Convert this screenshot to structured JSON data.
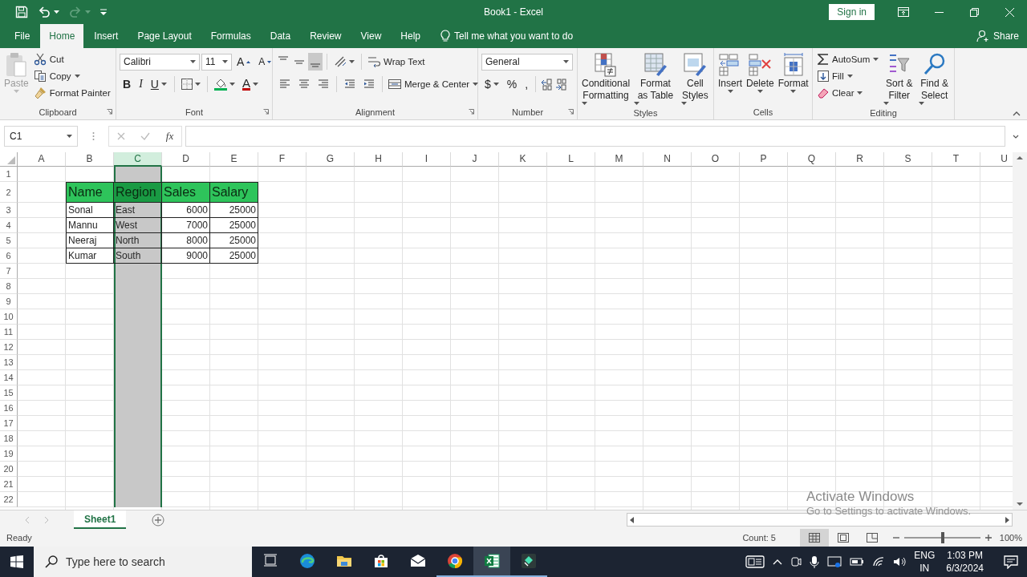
{
  "window": {
    "title": "Book1  -  Excel",
    "sign_in": "Sign in"
  },
  "quick_access": {
    "undo": {
      "disabled": false
    },
    "redo": {
      "disabled": true
    }
  },
  "tabs": [
    {
      "label": "File",
      "selected": false
    },
    {
      "label": "Home",
      "selected": true
    },
    {
      "label": "Insert",
      "selected": false
    },
    {
      "label": "Page Layout",
      "selected": false
    },
    {
      "label": "Formulas",
      "selected": false
    },
    {
      "label": "Data",
      "selected": false
    },
    {
      "label": "Review",
      "selected": false
    },
    {
      "label": "View",
      "selected": false
    },
    {
      "label": "Help",
      "selected": false
    }
  ],
  "tell_me": "Tell me what you want to do",
  "share": "Share",
  "ribbon": {
    "clipboard": {
      "label": "Clipboard",
      "paste": {
        "label": "Paste",
        "disabled": true
      },
      "commands": [
        "Cut",
        "Copy",
        "Format Painter"
      ]
    },
    "font": {
      "label": "Font",
      "font_name": "Calibri",
      "font_size": "11",
      "grow": "A",
      "shrink": "A",
      "styles": [
        "B",
        "I",
        "U"
      ],
      "font_color": "A"
    },
    "alignment": {
      "label": "Alignment",
      "vertical": [
        {
          "selected": false
        },
        {
          "selected": false
        },
        {
          "selected": true
        }
      ],
      "wrap_text": "Wrap Text",
      "merge": "Merge & Center"
    },
    "number": {
      "label": "Number",
      "format": "General",
      "symbols": [
        "$",
        "%",
        ","
      ]
    },
    "styles": {
      "label": "Styles",
      "commands": [
        "Conditional Formatting",
        "Format as Table",
        "Cell Styles"
      ]
    },
    "cells": {
      "label": "Cells",
      "commands": [
        "Insert",
        "Delete",
        "Format"
      ]
    },
    "editing": {
      "label": "Editing",
      "commands": [
        "AutoSum",
        "Fill",
        "Clear"
      ],
      "large": [
        "Sort & Filter",
        "Find & Select"
      ]
    }
  },
  "formula_bar": {
    "name_box": "C1",
    "function_label": "fx"
  },
  "sheet": {
    "columns": [
      {
        "label": "A",
        "selected": false
      },
      {
        "label": "B",
        "selected": false
      },
      {
        "label": "C",
        "selected": true
      },
      {
        "label": "D",
        "selected": false
      },
      {
        "label": "E",
        "selected": false
      },
      {
        "label": "F",
        "selected": false
      },
      {
        "label": "G",
        "selected": false
      },
      {
        "label": "H",
        "selected": false
      },
      {
        "label": "I",
        "selected": false
      },
      {
        "label": "J",
        "selected": false
      },
      {
        "label": "K",
        "selected": false
      },
      {
        "label": "L",
        "selected": false
      },
      {
        "label": "M",
        "selected": false
      },
      {
        "label": "N",
        "selected": false
      },
      {
        "label": "O",
        "selected": false
      },
      {
        "label": "P",
        "selected": false
      },
      {
        "label": "Q",
        "selected": false
      },
      {
        "label": "R",
        "selected": false
      },
      {
        "label": "S",
        "selected": false
      },
      {
        "label": "T",
        "selected": false
      },
      {
        "label": "U",
        "selected": false
      }
    ],
    "rows": [
      "1",
      "2",
      "3",
      "4",
      "5",
      "6",
      "7",
      "8",
      "9",
      "10",
      "11",
      "12",
      "13",
      "14",
      "15",
      "16",
      "17",
      "18",
      "19",
      "20",
      "21",
      "22"
    ],
    "table": {
      "columns": [
        {
          "label": "Name",
          "numeric": false
        },
        {
          "label": "Region",
          "numeric": false
        },
        {
          "label": "Sales",
          "numeric": true
        },
        {
          "label": "Salary",
          "numeric": true
        }
      ],
      "rows": [
        [
          "Sonal",
          "East",
          "6000",
          "25000"
        ],
        [
          "Mannu",
          "West",
          "7000",
          "25000"
        ],
        [
          "Neeraj",
          "North",
          "8000",
          "25000"
        ],
        [
          "Kumar",
          "South",
          "9000",
          "25000"
        ]
      ]
    }
  },
  "sheet_tabs": [
    {
      "label": "Sheet1",
      "selected": true
    }
  ],
  "status_bar": {
    "mode": "Ready",
    "count": "Count: 5",
    "views": [
      {
        "selected": true
      },
      {
        "selected": false
      },
      {
        "selected": false
      }
    ],
    "zoom": {
      "level": 0.5,
      "reading": "100%"
    }
  },
  "taskbar": {
    "search": {
      "placeholder": "Type here to search"
    },
    "apps": [
      {
        "running": false,
        "selected": false
      },
      {
        "running": false,
        "selected": false
      },
      {
        "running": false,
        "selected": false
      },
      {
        "running": false,
        "selected": false
      },
      {
        "running": false,
        "selected": false
      },
      {
        "running": true,
        "selected": false
      },
      {
        "running": true,
        "selected": true
      },
      {
        "running": true,
        "selected": false
      }
    ],
    "tray": {
      "language": "ENG",
      "region": "IN",
      "time": "1:03 PM",
      "date": "6/3/2024"
    }
  },
  "activation_notice": {
    "title": "Activate Windows",
    "message": "Go to Settings to activate Windows."
  }
}
